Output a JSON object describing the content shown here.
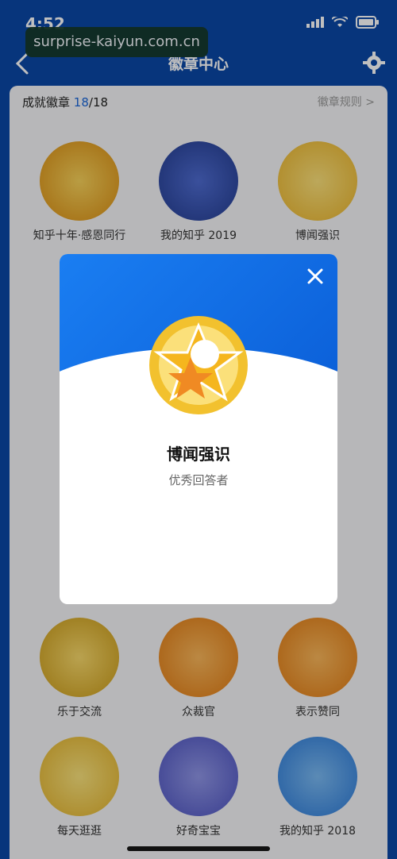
{
  "status": {
    "time": "4:52",
    "location_icon": "location-arrow-icon",
    "signal_icon": "signal-icon",
    "wifi_icon": "wifi-icon",
    "battery_icon": "battery-icon"
  },
  "watermark": "surprise-kaiyun.com.cn",
  "nav": {
    "title": "徽章中心",
    "back_icon": "back-arrow-icon",
    "settings_icon": "gear-icon"
  },
  "header": {
    "label": "成就徽章",
    "count_earned": "18",
    "count_total": "/18",
    "rules": "徽章规则 >"
  },
  "badges": [
    {
      "name": "知乎十年·感恩同行",
      "color": "#e8a31a"
    },
    {
      "name": "我的知乎 2019",
      "color": "#2e4aa8"
    },
    {
      "name": "博闻强识",
      "color": "#f2c12e"
    },
    {
      "name": "乐于交流",
      "color": "#e7b629"
    },
    {
      "name": "众裁官",
      "color": "#f08a23"
    },
    {
      "name": "表示赞同",
      "color": "#f08a23"
    },
    {
      "name": "每天逛逛",
      "color": "#f2c12e"
    },
    {
      "name": "好奇宝宝",
      "color": "#5b62c9"
    },
    {
      "name": "我的知乎 2018",
      "color": "#3a8be0"
    }
  ],
  "dialog": {
    "title": "博闻强识",
    "subtitle": "优秀回答者",
    "close_icon": "close-icon"
  },
  "colors": {
    "brand": "#0a47a6",
    "accent": "#1a66d9",
    "dialog_blue": "#1a7ef2"
  }
}
